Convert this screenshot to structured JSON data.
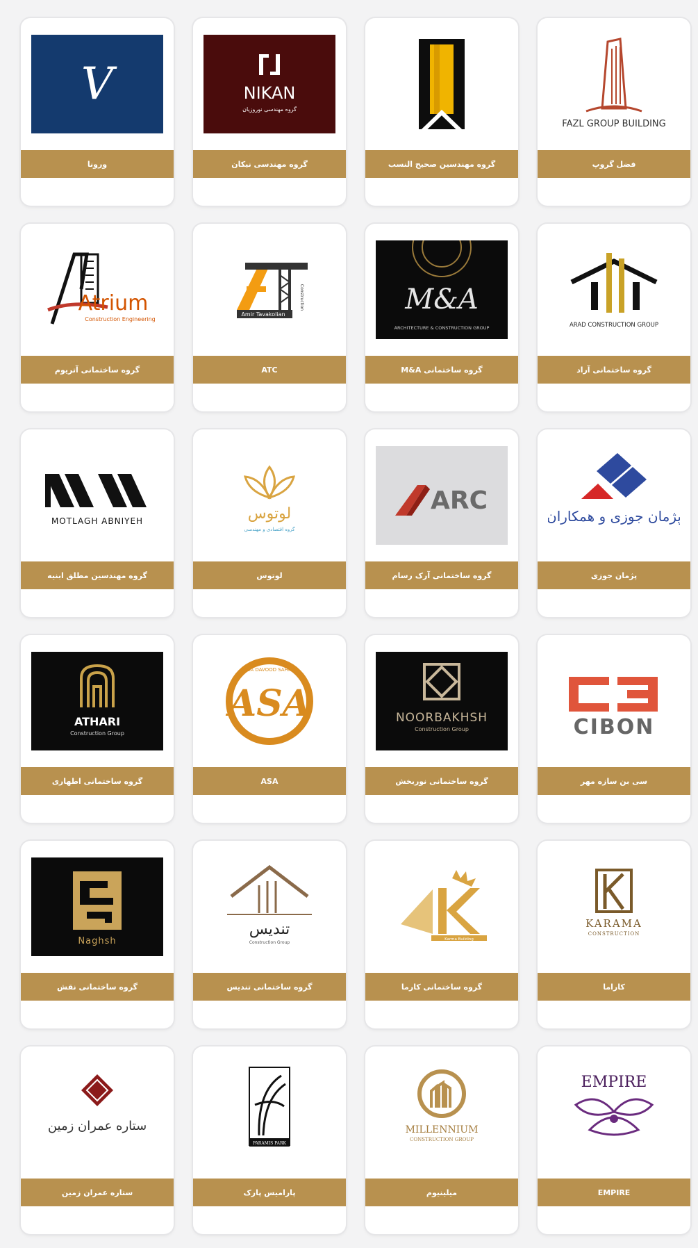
{
  "colors": {
    "band": "#b8914f",
    "page_bg": "#f3f3f4",
    "card_bg": "#ffffff"
  },
  "cards": [
    {
      "label": "ورونا",
      "logo_icon": "verona-logo-icon",
      "logo_text": "V"
    },
    {
      "label": "گروه مهندسی نیکان",
      "logo_icon": "nikan-logo-icon",
      "logo_text": "NIKAN",
      "logo_subtext": "گروه مهندسی نوروزیان"
    },
    {
      "label": "گروه مهندسین صحیح النسب",
      "logo_icon": "sahih-logo-icon"
    },
    {
      "label": "فضل گروپ",
      "logo_icon": "fazl-logo-icon",
      "logo_text": "FAZL GROUP BUILDING"
    },
    {
      "label": "گروه ساختمانی آتریوم",
      "logo_icon": "atrium-logo-icon",
      "logo_text": "Atrium",
      "logo_subtext": "Construction Engineering"
    },
    {
      "label": "ATC",
      "logo_icon": "atc-logo-icon",
      "logo_text": "Amir Tavakolian",
      "logo_subtext": "Construction"
    },
    {
      "label": "گروه ساختمانی M&A",
      "logo_icon": "ma-logo-icon",
      "logo_text": "M&A",
      "logo_subtext": "ARCHITECTURE & CONSTRUCTION GROUP"
    },
    {
      "label": "گروه ساختمانی آراد",
      "logo_icon": "arad-logo-icon",
      "logo_text": "ARAD CONSTRUCTION GROUP"
    },
    {
      "label": "گروه مهندسین مطلق ابنیه",
      "logo_icon": "motlagh-logo-icon",
      "logo_text": "MOTLAGH ABNIYEH"
    },
    {
      "label": "لوتوس",
      "logo_icon": "lotus-logo-icon",
      "logo_text": "لوتوس",
      "logo_subtext": "گروه اقتصادی و مهندسی"
    },
    {
      "label": "گروه ساختمانی آرک رسام",
      "logo_icon": "arc-logo-icon",
      "logo_text": "ARC"
    },
    {
      "label": "پژمان جوزی",
      "logo_icon": "pejman-logo-icon",
      "logo_text": "پژمان جوزی و همکاران"
    },
    {
      "label": "گروه ساختمانی اطهاری",
      "logo_icon": "athari-logo-icon",
      "logo_text": "ATHARI",
      "logo_subtext": "Construction Group"
    },
    {
      "label": "ASA",
      "logo_icon": "asa-logo-icon",
      "logo_text": "ASA",
      "logo_subtext": "ASA DAVOOD SAHIMI"
    },
    {
      "label": "گروه ساختمانی نوربخش",
      "logo_icon": "noorbakhsh-logo-icon",
      "logo_text": "NOORBAKHSH",
      "logo_subtext": "Construction Group"
    },
    {
      "label": "سی بن سازه مهر",
      "logo_icon": "cibon-logo-icon",
      "logo_text": "CIBON"
    },
    {
      "label": "گروه ساختمانی نقش",
      "logo_icon": "naghsh-logo-icon",
      "logo_text": "Naghsh"
    },
    {
      "label": "گروه ساختمانی تندیس",
      "logo_icon": "tandis-logo-icon",
      "logo_text": "تندیس",
      "logo_subtext": "Construction Group"
    },
    {
      "label": "گروه ساختمانی کارما",
      "logo_icon": "karma-logo-icon",
      "logo_text": "Karma Building"
    },
    {
      "label": "کاراما",
      "logo_icon": "karama-logo-icon",
      "logo_text": "KARAMA",
      "logo_subtext": "CONSTRUCTION"
    },
    {
      "label": "ستاره عمران زمین",
      "logo_icon": "setareh-logo-icon",
      "logo_text": "ستاره عمران زمین"
    },
    {
      "label": "پارامیس پارک",
      "logo_icon": "paramis-logo-icon",
      "logo_text": "PARAMIS PARK"
    },
    {
      "label": "میلینیوم",
      "logo_icon": "millennium-logo-icon",
      "logo_text": "MILLENNIUM",
      "logo_subtext": "CONSTRUCTION GROUP"
    },
    {
      "label": "EMPIRE",
      "logo_icon": "empire-logo-icon",
      "logo_text": "EMPIRE"
    }
  ]
}
